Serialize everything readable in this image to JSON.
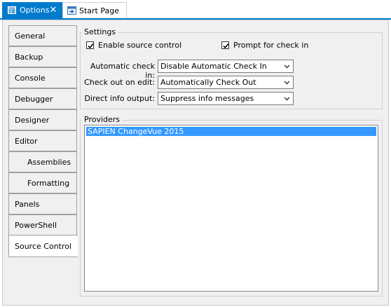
{
  "tabs": {
    "options_label": "Options",
    "close_glyph": "✕",
    "start_label": "Start Page"
  },
  "categories": [
    "General",
    "Backup",
    "Console",
    "Debugger",
    "Designer",
    "Editor",
    "Assemblies",
    "Formatting",
    "Panels",
    "PowerShell",
    "Source Control"
  ],
  "selected_category": "Source Control",
  "settings": {
    "title": "Settings",
    "enable_source_control": {
      "label": "Enable source control",
      "checked": true
    },
    "prompt_for_check_in": {
      "label": "Prompt for check in",
      "checked": true
    },
    "automatic_check_in": {
      "label": "Automatic check in:",
      "value": "Disable Automatic Check In"
    },
    "check_out_on_edit": {
      "label": "Check out on edit:",
      "value": "Automatically Check Out"
    },
    "direct_info_output": {
      "label": "Direct info output:",
      "value": "Suppress info messages"
    }
  },
  "providers": {
    "title": "Providers",
    "items": [
      "SAPIEN ChangeVue 2015"
    ]
  },
  "colors": {
    "accent": "#007acc",
    "selection": "#3399ff"
  },
  "icons": {
    "options": "options-grid-icon",
    "start_page": "start-page-icon",
    "close": "close-icon",
    "check": "checkmark-icon",
    "dropdown": "chevron-down-icon"
  }
}
